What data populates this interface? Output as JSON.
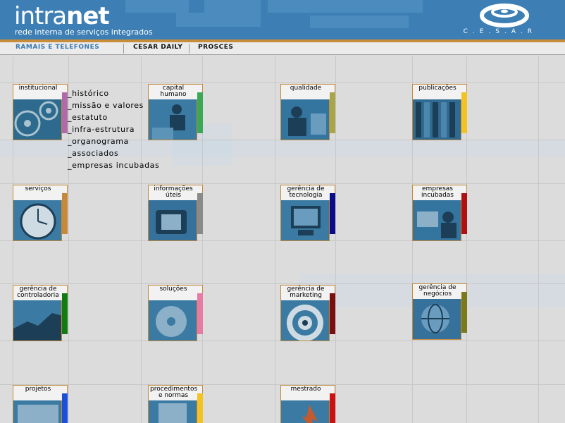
{
  "header": {
    "logo_main": "intra",
    "logo_bold": "net",
    "tagline": "rede interna de serviços integrados",
    "org": "C.E.S.A.R"
  },
  "nav": {
    "items": [
      "RAMAIS E TELEFONES",
      "CESAR DAILY",
      "PROSCES"
    ]
  },
  "colors": {
    "header": "#3d7fb5",
    "stripe": "#c88d3a",
    "tile_border": "#c38a3b"
  },
  "tiles": [
    {
      "label": "institucional",
      "bar": "#b16aa8"
    },
    {
      "label": "capital humano",
      "bar": "#3aa855"
    },
    {
      "label": "qualidade",
      "bar": "#a9a548"
    },
    {
      "label": "publicações",
      "bar": "#f2c322"
    },
    {
      "label": "serviços",
      "bar": "#c6893b"
    },
    {
      "label": "informações úteis",
      "bar": "#8a8a8a"
    },
    {
      "label": "gerência de tecnologia",
      "bar": "#0b0b8a"
    },
    {
      "label": "empresas incubadas",
      "bar": "#b01010"
    },
    {
      "label": "gerência de controladoria",
      "bar": "#127a12"
    },
    {
      "label": "soluções",
      "bar": "#e87aa3"
    },
    {
      "label": "gerência de marketing",
      "bar": "#7a0f0f"
    },
    {
      "label": "gerência de negócios",
      "bar": "#7a7a1a"
    },
    {
      "label": "projetos",
      "bar": "#1a4fd6"
    },
    {
      "label": "procedimentos e normas",
      "bar": "#f2c322"
    },
    {
      "label": "mestrado",
      "bar": "#cc1111"
    }
  ],
  "submenu": {
    "items": [
      "_histórico",
      "_missão e valores",
      "_estatuto",
      "_infra-estrutura",
      "_organograma",
      "_associados",
      "_empresas incubadas"
    ]
  }
}
